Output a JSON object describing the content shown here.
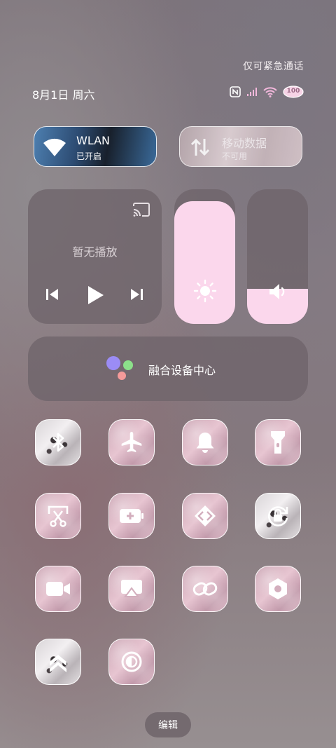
{
  "status": {
    "emergency_text": "仅可紧急通话",
    "date_text": "8月1日 周六",
    "battery_text": "100"
  },
  "wlan": {
    "title": "WLAN",
    "subtitle": "已开启"
  },
  "mobile_data": {
    "title": "移动数据",
    "subtitle": "不可用"
  },
  "media": {
    "empty_text": "暂无播放"
  },
  "brightness": {
    "level": 0.91
  },
  "volume": {
    "level": 0.26
  },
  "fusion": {
    "label": "融合设备中心"
  },
  "tiles": [
    {
      "icon": "bluetooth-icon",
      "style": "leopard"
    },
    {
      "icon": "airplane-icon",
      "style": "pink"
    },
    {
      "icon": "bell-icon",
      "style": "pink"
    },
    {
      "icon": "flashlight-icon",
      "style": "pink"
    },
    {
      "icon": "screenshot-icon",
      "style": "pink"
    },
    {
      "icon": "battery-saver-icon",
      "style": "pink"
    },
    {
      "icon": "share-icon",
      "style": "pink"
    },
    {
      "icon": "rotation-lock-icon",
      "style": "leopard"
    },
    {
      "icon": "screen-record-icon",
      "style": "pink"
    },
    {
      "icon": "cast-screen-icon",
      "style": "pink"
    },
    {
      "icon": "link-icon",
      "style": "pink"
    },
    {
      "icon": "nfc-settings-icon",
      "style": "pink"
    },
    {
      "icon": "performance-icon",
      "style": "leopard"
    },
    {
      "icon": "eye-comfort-icon",
      "style": "pink"
    }
  ],
  "edit_label": "编辑",
  "colors": {
    "slider_fill": "#fbd7ec",
    "panel_bg": "#6e646a"
  }
}
